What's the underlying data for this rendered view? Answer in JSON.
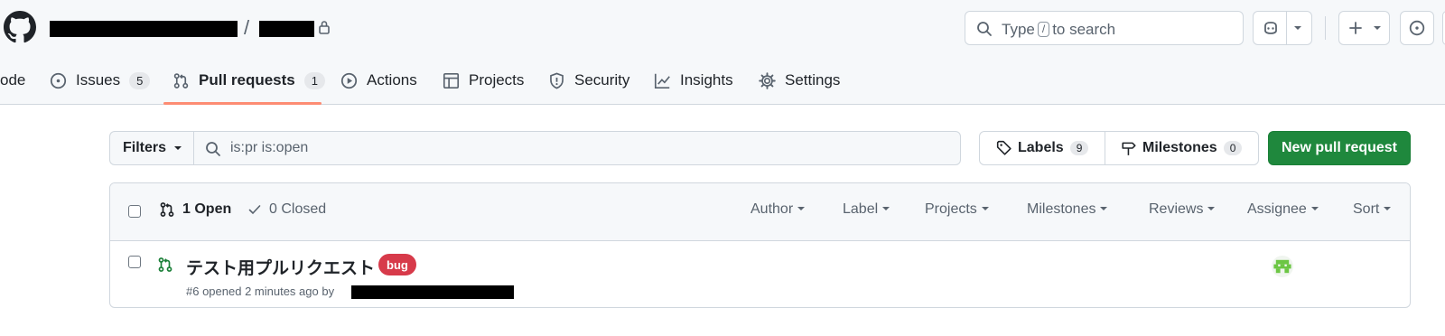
{
  "header": {
    "search_text_before": "Type",
    "search_key": "/",
    "search_text_after": "to search"
  },
  "nav": {
    "tabs": [
      {
        "label": "ode",
        "icon": "code-icon"
      },
      {
        "label": "Issues",
        "count": "5",
        "icon": "issue-opened-icon"
      },
      {
        "label": "Pull requests",
        "count": "1",
        "icon": "git-pull-request-icon",
        "active": true
      },
      {
        "label": "Actions",
        "icon": "play-icon"
      },
      {
        "label": "Projects",
        "icon": "table-icon"
      },
      {
        "label": "Security",
        "icon": "shield-icon"
      },
      {
        "label": "Insights",
        "icon": "graph-icon"
      },
      {
        "label": "Settings",
        "icon": "gear-icon"
      }
    ]
  },
  "filterbar": {
    "filters_label": "Filters",
    "query": "is:pr is:open",
    "labels_label": "Labels",
    "labels_count": "9",
    "milestones_label": "Milestones",
    "milestones_count": "0",
    "new_pr_label": "New pull request"
  },
  "list": {
    "open_label": "1 Open",
    "closed_label": "0 Closed",
    "header_filters": [
      "Author",
      "Label",
      "Projects",
      "Milestones",
      "Reviews",
      "Assignee",
      "Sort"
    ],
    "rows": [
      {
        "title": "テスト用プルリクエスト",
        "label": "bug",
        "label_color": "#d73a4a",
        "meta": "#6 opened 2 minutes ago by"
      }
    ]
  },
  "colors": {
    "primary_button": "#1f883d",
    "tab_underline": "#fd8c73",
    "open_pr": "#1a7f37"
  }
}
